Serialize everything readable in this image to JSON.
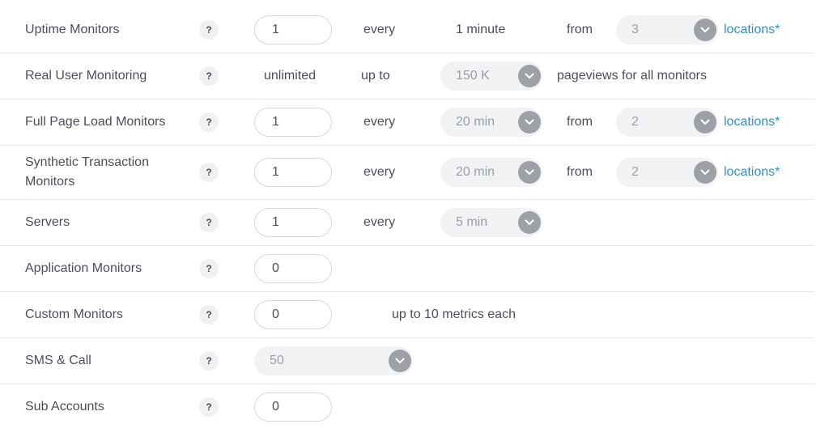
{
  "help_glyph": "?",
  "rows": [
    {
      "label": "Uptime Monitors",
      "input_value": "1",
      "every_text": "every",
      "interval_text": "1 minute",
      "from_text": "from",
      "locations_select": "3",
      "locations_link": "locations*"
    },
    {
      "label": "Real User Monitoring",
      "value_text": "unlimited",
      "upto_text": "up to",
      "pageviews_select": "150 K",
      "suffix_text": "pageviews for all monitors"
    },
    {
      "label": "Full Page Load Monitors",
      "input_value": "1",
      "every_text": "every",
      "interval_select": "20 min",
      "from_text": "from",
      "locations_select": "2",
      "locations_link": "locations*"
    },
    {
      "label": "Synthetic Transaction Monitors",
      "input_value": "1",
      "every_text": "every",
      "interval_select": "20 min",
      "from_text": "from",
      "locations_select": "2",
      "locations_link": "locations*"
    },
    {
      "label": "Servers",
      "input_value": "1",
      "every_text": "every",
      "interval_select": "5 min"
    },
    {
      "label": "Application Monitors",
      "input_value": "0"
    },
    {
      "label": "Custom Monitors",
      "input_value": "0",
      "note_text": "up to 10 metrics each"
    },
    {
      "label": "SMS & Call",
      "credits_select": "50"
    },
    {
      "label": "Sub Accounts",
      "input_value": "0"
    }
  ],
  "colors": {
    "text": "#4a4f57",
    "link": "#2f8fc7",
    "select_bg": "#f1f2f4",
    "select_text": "#9a9fa6",
    "chevron_bg": "#9da1a7",
    "divider": "#e6e8eb"
  },
  "icons": {
    "help": "question-mark-icon",
    "dropdown": "chevron-down-icon"
  }
}
